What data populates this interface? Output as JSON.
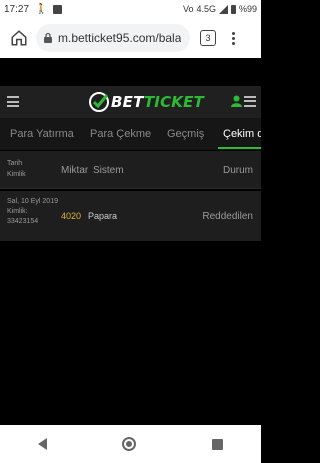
{
  "status_bar": {
    "time": "17:27",
    "network": "4.5G",
    "battery": "%99"
  },
  "browser": {
    "url": "m.betticket95.com/bala",
    "tab_count": "3"
  },
  "site": {
    "logo_check": "",
    "logo_part1": "BET",
    "logo_part2": "TICKET",
    "brand_color": "#2dbb35"
  },
  "tabs": [
    {
      "label": "Para Yatırma"
    },
    {
      "label": "Para Çekme"
    },
    {
      "label": "Geçmiş"
    },
    {
      "label": "Çekim du"
    }
  ],
  "table": {
    "headers": {
      "date": "Tarih",
      "id": "Kimlik",
      "amount": "Miktar",
      "system": "Sistem",
      "status": "Durum"
    },
    "rows": [
      {
        "date": "Sal, 10 Eyl 2019",
        "id_label": "Kimlik:",
        "id": "33423154",
        "amount": "4020",
        "system": "Papara",
        "status": "Reddedilen"
      }
    ]
  }
}
